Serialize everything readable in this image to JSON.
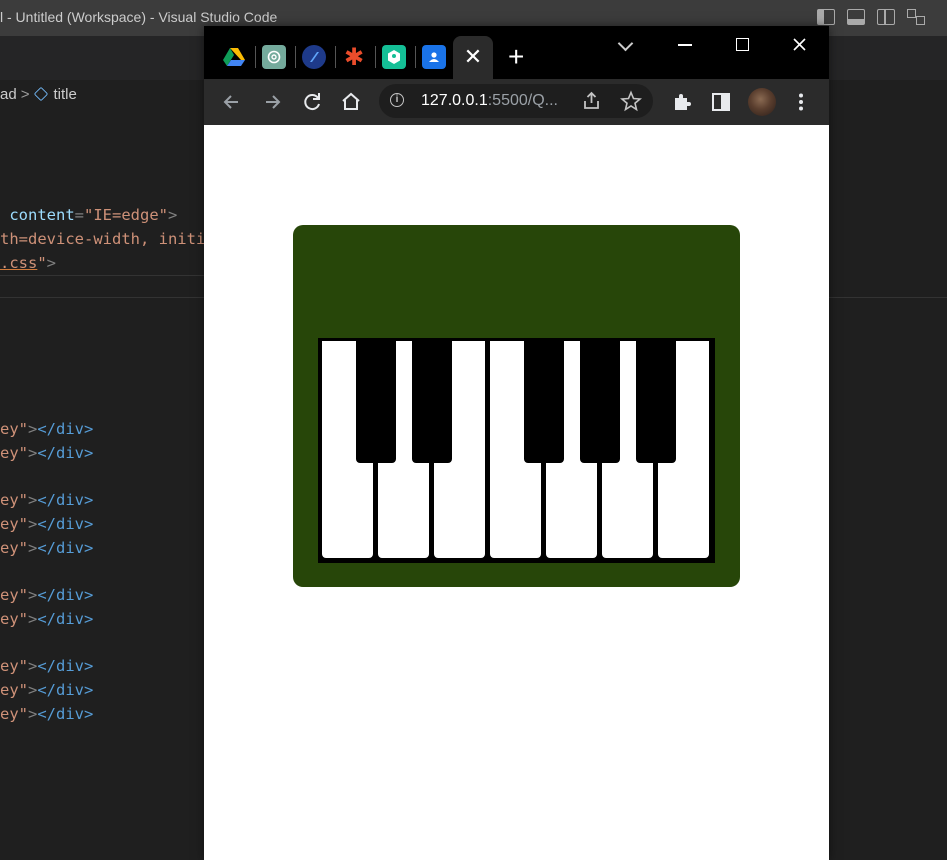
{
  "vscode": {
    "window_title": "l - Untitled (Workspace) - Visual Studio Code",
    "breadcrumb": {
      "parent": "ad",
      "current": "title"
    },
    "code_lines": {
      "line1": {
        "attr": "content",
        "value": "\"IE=edge\""
      },
      "line2": "th=device-width, initi",
      "line3": ".css"
    },
    "key_line_text": {
      "quote": "ey\"",
      "close_tag": "</div>"
    }
  },
  "browser": {
    "tabs": [
      {
        "icon": "google-drive-icon"
      },
      {
        "icon": "chatgpt-icon"
      },
      {
        "icon": "tab-app-icon"
      },
      {
        "icon": "asterisk-icon"
      },
      {
        "icon": "khan-academy-icon"
      },
      {
        "icon": "contacts-icon"
      },
      {
        "icon": "active-blank-tab",
        "close_glyph": "✕"
      }
    ],
    "new_tab_glyph": "+",
    "url": {
      "host": "127.0.0.1",
      "rest": ":5500/Q..."
    }
  },
  "page": {
    "piano": {
      "case_color": "#274609",
      "white_key_count": 7,
      "black_key_count": 5
    }
  }
}
